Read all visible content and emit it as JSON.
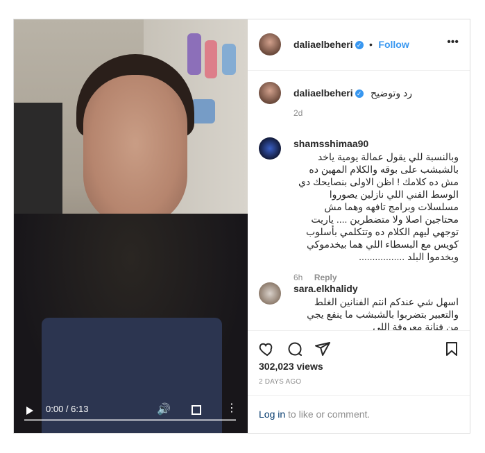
{
  "post": {
    "author": "daliaelbeheri",
    "follow_label": "Follow",
    "more_label": "•••",
    "caption": {
      "username": "daliaelbeheri",
      "text": "رد وتوضيح",
      "time": "2d"
    },
    "comments": [
      {
        "username": "shamsshimaa90",
        "text": "وبالنسبة للي يقول عمالة يومية ياخد بالشبشب على بوقه والكلام المهين ده مش ده كلامك ! اظن الاولى بنصايحك دي الوسط الفني اللي نازلين يصوروا مسلسلات وبرامج تافهه وهما مش محتاجين اصلا ولا متضطرين .... ياريت توجهي ليهم الكلام ده وتتكلمي بأسلوب كويس مع البسطاء اللي هما بيخدموكي ويخدموا البلد .................",
        "time": "6h",
        "reply_label": "Reply"
      },
      {
        "username": "sara.elkhalidy",
        "text": "اسهل شي عندكم انتم الفنانين الغلط والتعبير بتضربوا بالشبشب ما ينفع يجي من فنانة معروفة اللي",
        "time": "",
        "reply_label": ""
      }
    ],
    "views": "302,023 views",
    "date": "2 DAYS AGO",
    "login_link": "Log in",
    "login_rest": " to like or comment.",
    "video": {
      "time": "0:00 / 6:13"
    }
  },
  "colors": {
    "accent": "#3897f0",
    "border": "#dbdbdb",
    "muted": "#8e8e8e"
  }
}
